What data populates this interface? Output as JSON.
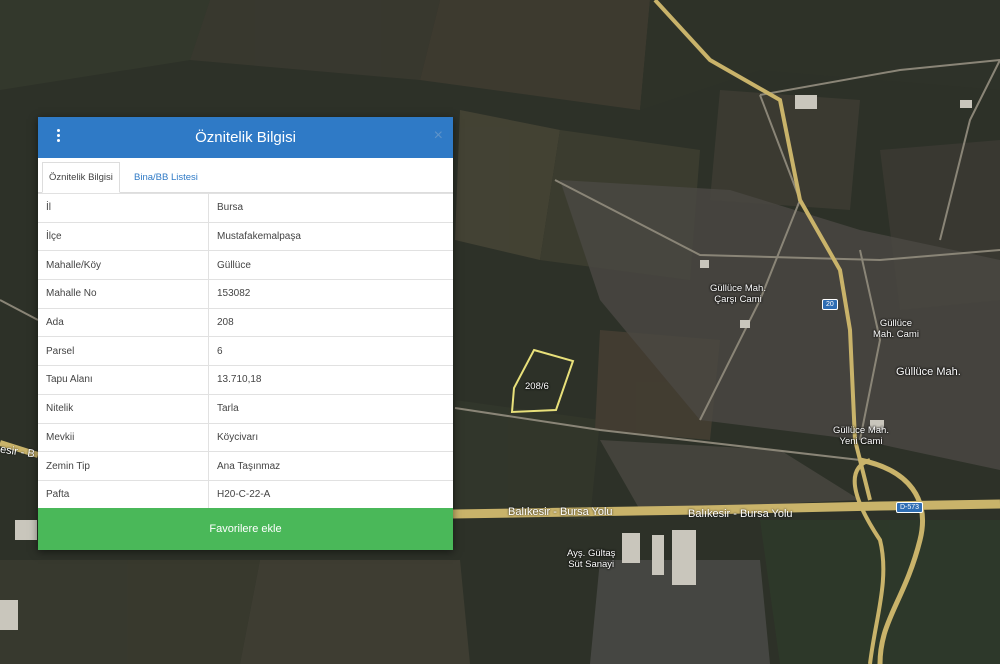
{
  "panel": {
    "title": "Öznitelik Bilgisi",
    "tabs": [
      {
        "label": "Öznitelik Bilgisi"
      },
      {
        "label": "Bina/BB Listesi"
      }
    ],
    "rows": [
      {
        "key": "İl",
        "value": "Bursa"
      },
      {
        "key": "İlçe",
        "value": "Mustafakemalpaşa"
      },
      {
        "key": "Mahalle/Köy",
        "value": "Güllüce"
      },
      {
        "key": "Mahalle No",
        "value": "153082"
      },
      {
        "key": "Ada",
        "value": "208"
      },
      {
        "key": "Parsel",
        "value": "6"
      },
      {
        "key": "Tapu Alanı",
        "value": "13.710,18"
      },
      {
        "key": "Nitelik",
        "value": "Tarla"
      },
      {
        "key": "Mevkii",
        "value": "Köycivarı"
      },
      {
        "key": "Zemin Tip",
        "value": "Ana Taşınmaz"
      },
      {
        "key": "Pafta",
        "value": "H20-C-22-A"
      }
    ],
    "favorite_button": "Favorilere ekle",
    "close_icon": "×"
  },
  "map": {
    "parcel_label": "208/6",
    "labels": {
      "mosque1_line1": "Güllüce Mah.",
      "mosque1_line2": "Çarşı Cami",
      "mosque2_line1": "Güllüce",
      "mosque2_line2": "Mah. Cami",
      "village": "Güllüce Mah.",
      "mosque3_line1": "Güllüce Mah.",
      "mosque3_line2": "Yeni Cami",
      "dairy_line1": "Ayş. Gültaş",
      "dairy_line2": "Süt Sanayi",
      "road1": "Balıkesir - Bursa Yolu",
      "road2": "Balıkesir - Bursa Yolu",
      "road_left": "esir - B",
      "route_shield": "D-573",
      "shield_small": "20"
    },
    "colors": {
      "road": "#c9b36a",
      "parcel_outline": "#e8e07a",
      "header": "#2f7ac6",
      "fav_button": "#4ab859"
    }
  }
}
